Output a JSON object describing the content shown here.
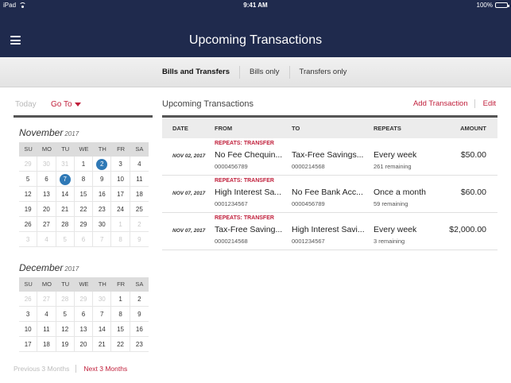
{
  "status_bar": {
    "device": "iPad",
    "time": "9:41 AM",
    "battery": "100%"
  },
  "header": {
    "title": "Upcoming Transactions"
  },
  "filters": [
    {
      "label": "Bills and Transfers",
      "active": true
    },
    {
      "label": "Bills only",
      "active": false
    },
    {
      "label": "Transfers only",
      "active": false
    }
  ],
  "calendar": {
    "today_label": "Today",
    "goto_label": "Go To",
    "weekdays": [
      "SU",
      "MO",
      "TU",
      "WE",
      "TH",
      "FR",
      "SA"
    ],
    "months": [
      {
        "name": "November",
        "year": "2017",
        "days": [
          {
            "d": "29",
            "m": true
          },
          {
            "d": "30",
            "m": true
          },
          {
            "d": "31",
            "m": true
          },
          {
            "d": "1"
          },
          {
            "d": "2",
            "c": true
          },
          {
            "d": "3"
          },
          {
            "d": "4"
          },
          {
            "d": "5"
          },
          {
            "d": "6"
          },
          {
            "d": "7",
            "c": true
          },
          {
            "d": "8"
          },
          {
            "d": "9"
          },
          {
            "d": "10"
          },
          {
            "d": "11"
          },
          {
            "d": "12"
          },
          {
            "d": "13"
          },
          {
            "d": "14"
          },
          {
            "d": "15"
          },
          {
            "d": "16"
          },
          {
            "d": "17"
          },
          {
            "d": "18"
          },
          {
            "d": "19"
          },
          {
            "d": "20"
          },
          {
            "d": "21"
          },
          {
            "d": "22"
          },
          {
            "d": "23"
          },
          {
            "d": "24"
          },
          {
            "d": "25"
          },
          {
            "d": "26"
          },
          {
            "d": "27"
          },
          {
            "d": "28"
          },
          {
            "d": "29"
          },
          {
            "d": "30"
          },
          {
            "d": "1",
            "m": true
          },
          {
            "d": "2",
            "m": true
          },
          {
            "d": "3",
            "m": true
          },
          {
            "d": "4",
            "m": true
          },
          {
            "d": "5",
            "m": true
          },
          {
            "d": "6",
            "m": true
          },
          {
            "d": "7",
            "m": true
          },
          {
            "d": "8",
            "m": true
          },
          {
            "d": "9",
            "m": true
          }
        ]
      },
      {
        "name": "December",
        "year": "2017",
        "days": [
          {
            "d": "26",
            "m": true
          },
          {
            "d": "27",
            "m": true
          },
          {
            "d": "28",
            "m": true
          },
          {
            "d": "29",
            "m": true
          },
          {
            "d": "30",
            "m": true
          },
          {
            "d": "1"
          },
          {
            "d": "2"
          },
          {
            "d": "3"
          },
          {
            "d": "4"
          },
          {
            "d": "5"
          },
          {
            "d": "6"
          },
          {
            "d": "7"
          },
          {
            "d": "8"
          },
          {
            "d": "9"
          },
          {
            "d": "10"
          },
          {
            "d": "11"
          },
          {
            "d": "12"
          },
          {
            "d": "13"
          },
          {
            "d": "14"
          },
          {
            "d": "15"
          },
          {
            "d": "16"
          },
          {
            "d": "17"
          },
          {
            "d": "18"
          },
          {
            "d": "19"
          },
          {
            "d": "20"
          },
          {
            "d": "21"
          },
          {
            "d": "22"
          },
          {
            "d": "23"
          }
        ]
      }
    ],
    "prev_label": "Previous 3 Months",
    "next_label": "Next 3 Months"
  },
  "content": {
    "title": "Upcoming Transactions",
    "add_label": "Add Transaction",
    "edit_label": "Edit",
    "columns": {
      "date": "DATE",
      "from": "FROM",
      "to": "TO",
      "repeats": "REPEATS",
      "amount": "AMOUNT"
    },
    "rows": [
      {
        "tag": "REPEATS: TRANSFER",
        "date": "NOV 02, 2017",
        "from": "No Fee Chequin...",
        "from_acc": "0000456789",
        "to": "Tax-Free Savings...",
        "to_acc": "0000214568",
        "repeats": "Every week",
        "remaining": "261 remaining",
        "amount": "$50.00"
      },
      {
        "tag": "REPEATS: TRANSFER",
        "date": "NOV 07, 2017",
        "from": "High Interest Sa...",
        "from_acc": "0001234567",
        "to": "No Fee Bank Acc...",
        "to_acc": "0000456789",
        "repeats": "Once a month",
        "remaining": "59 remaining",
        "amount": "$60.00"
      },
      {
        "tag": "REPEATS: TRANSFER",
        "date": "NOV 07, 2017",
        "from": "Tax-Free Saving...",
        "from_acc": "0000214568",
        "to": "High Interest Savi...",
        "to_acc": "0001234567",
        "repeats": "Every week",
        "remaining": "3 remaining",
        "amount": "$2,000.00"
      }
    ]
  },
  "colors": {
    "nav": "#1f2a4d",
    "accent": "#c01e3a",
    "highlight": "#2f79b6"
  }
}
